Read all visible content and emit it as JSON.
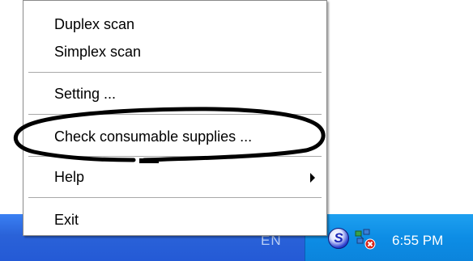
{
  "menu": {
    "items": [
      {
        "label": "Duplex scan"
      },
      {
        "label": "Simplex scan"
      },
      {
        "label": "Setting ..."
      },
      {
        "label": "Check consumable supplies ..."
      },
      {
        "label": "Help"
      },
      {
        "label": "Exit"
      }
    ]
  },
  "taskbar": {
    "language": "EN",
    "clock": "6:55 PM",
    "tray_icons": [
      "scanner-s-icon",
      "network-error-icon"
    ],
    "s_icon_letter": "S"
  },
  "colors": {
    "taskbar": "#245ad6",
    "tray": "#0d8de5",
    "annotation": "#000000"
  }
}
